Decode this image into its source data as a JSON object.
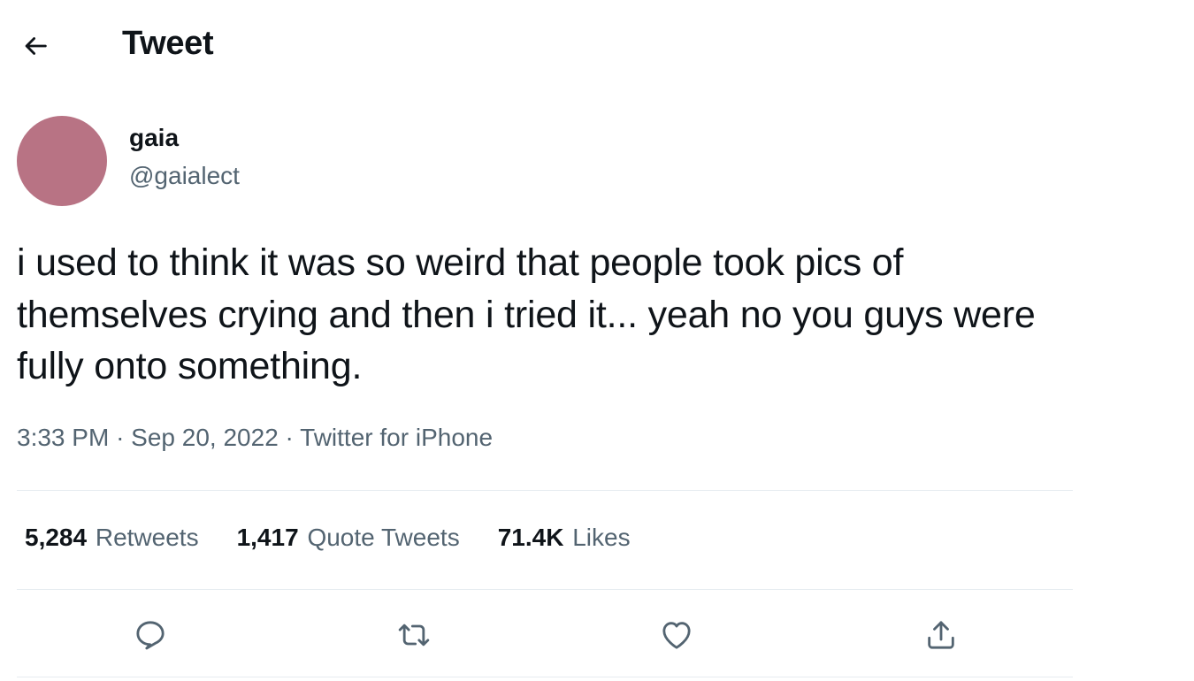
{
  "header": {
    "back_icon": "arrow-left-icon",
    "title": "Tweet"
  },
  "author": {
    "avatar_color": "#b87384",
    "display_name": "gaia",
    "handle": "@gaialect"
  },
  "tweet": {
    "text": "i used to think it was so weird that people took pics of themselves crying and then i tried it... yeah no you guys were fully onto something.",
    "time": "3:33 PM",
    "date": "Sep 20, 2022",
    "source": "Twitter for iPhone",
    "separator": "·"
  },
  "stats": {
    "retweets_count": "5,284",
    "retweets_label": "Retweets",
    "quotes_count": "1,417",
    "quotes_label": "Quote Tweets",
    "likes_count": "71.4K",
    "likes_label": "Likes"
  },
  "actions": [
    {
      "icon": "reply-icon"
    },
    {
      "icon": "retweet-icon"
    },
    {
      "icon": "like-icon"
    },
    {
      "icon": "share-icon"
    }
  ],
  "colors": {
    "text_primary": "#0f1419",
    "text_secondary": "#536471",
    "divider": "#e6ecf0"
  }
}
